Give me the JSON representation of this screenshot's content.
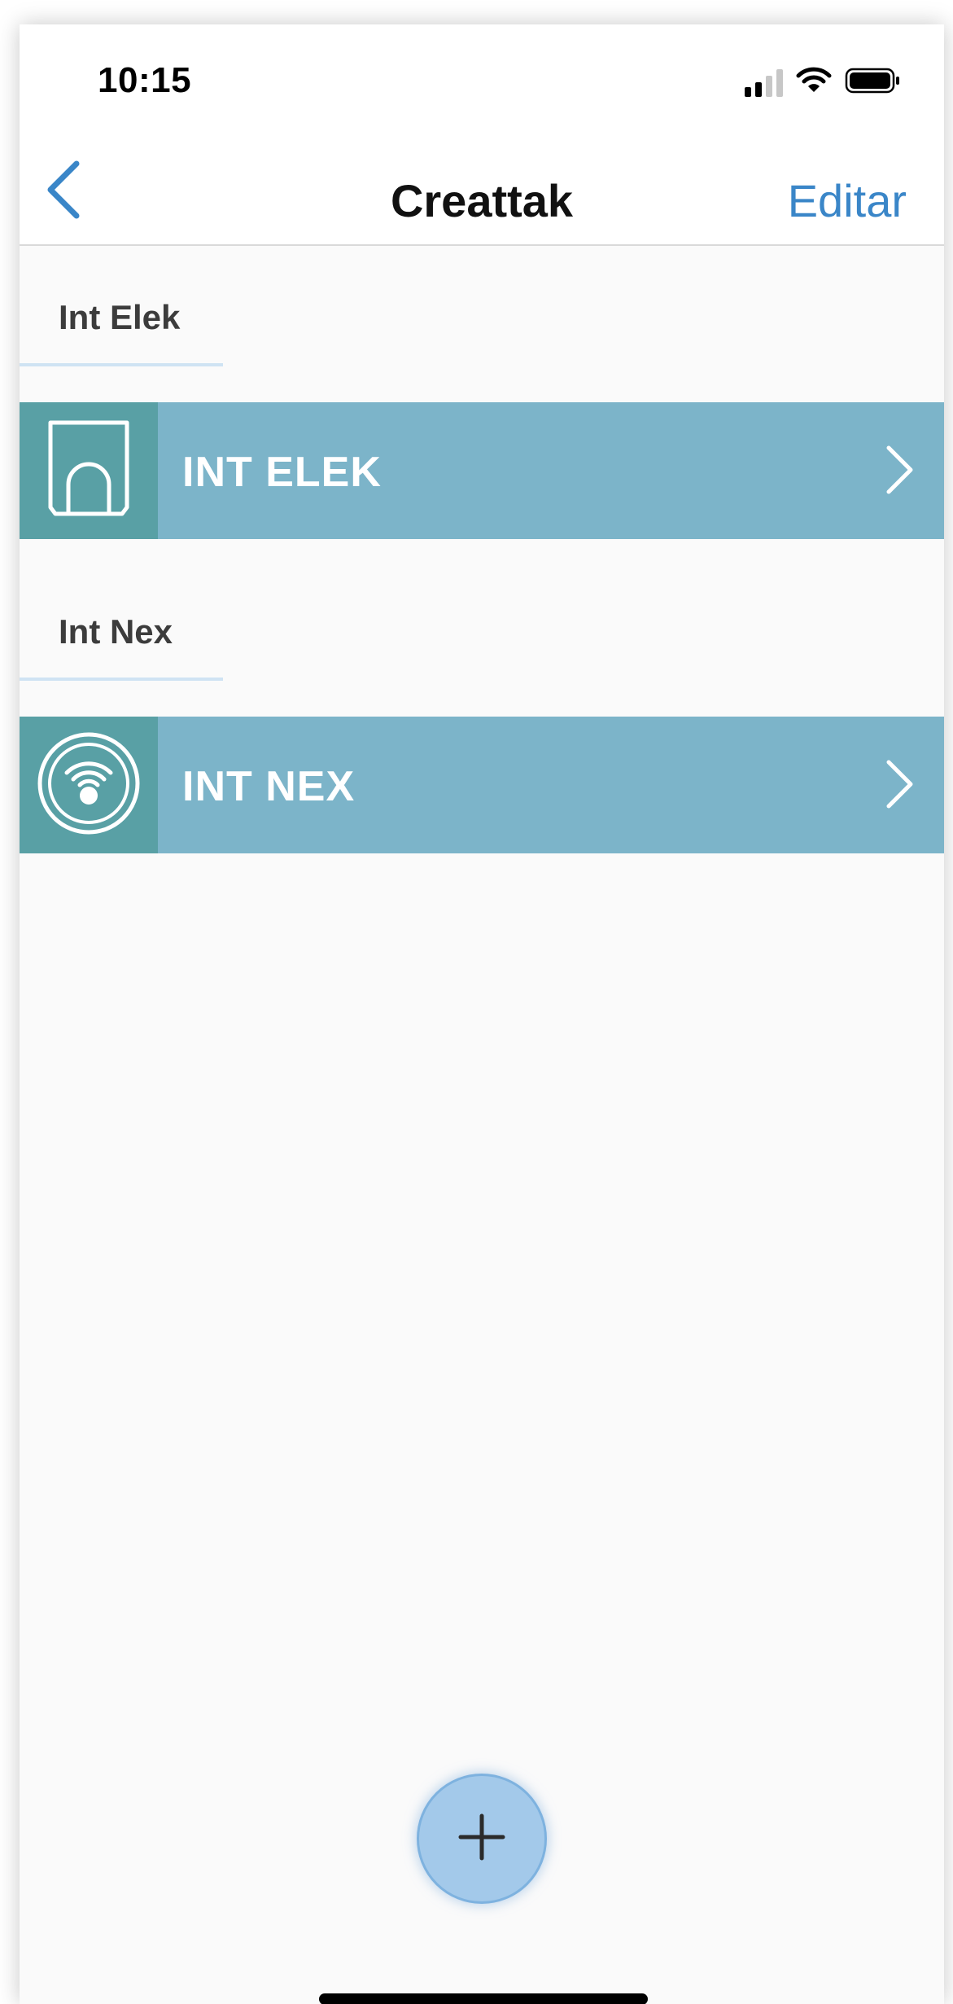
{
  "status_bar": {
    "time": "10:15",
    "icons": [
      "signal-icon",
      "wifi-icon",
      "battery-icon"
    ]
  },
  "nav": {
    "back_icon": "chevron-left-icon",
    "title": "Creattak",
    "edit_label": "Editar"
  },
  "sections": [
    {
      "header": "Int Elek",
      "item": {
        "label": "INT ELEK",
        "icon": "door-arch-icon"
      }
    },
    {
      "header": "Int Nex",
      "item": {
        "label": "INT NEX",
        "icon": "wireless-sensor-icon"
      }
    }
  ],
  "fab": {
    "icon": "plus-icon"
  },
  "colors": {
    "accent": "#3a86c8",
    "row_background": "#7cb4c9",
    "icon_box_background": "#59a0a5",
    "section_underline": "#cfe3f3",
    "fab_background": "#a3c9ea"
  }
}
